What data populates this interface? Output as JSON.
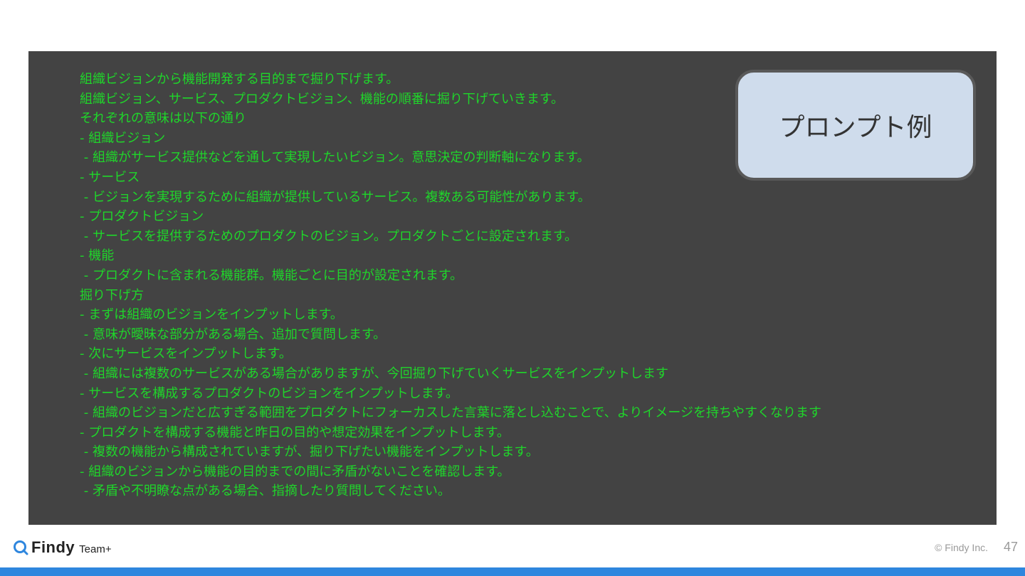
{
  "slide": {
    "callout": "プロンプト例",
    "prompt_lines": [
      "組織ビジョンから機能開発する目的まで掘り下げます。",
      "組織ビジョン、サービス、プロダクトビジョン、機能の順番に掘り下げていきます。",
      "それぞれの意味は以下の通り",
      "- 組織ビジョン",
      " - 組織がサービス提供などを通して実現したいビジョン。意思決定の判断軸になります。",
      "- サービス",
      " - ビジョンを実現するために組織が提供しているサービス。複数ある可能性があります。",
      "- プロダクトビジョン",
      " - サービスを提供するためのプロダクトのビジョン。プロダクトごとに設定されます。",
      "- 機能",
      " - プロダクトに含まれる機能群。機能ごとに目的が設定されます。",
      "掘り下げ方",
      "- まずは組織のビジョンをインプットします。",
      " - 意味が曖昧な部分がある場合、追加で質問します。",
      "- 次にサービスをインプットします。",
      " - 組織には複数のサービスがある場合がありますが、今回掘り下げていくサービスをインプットします",
      "- サービスを構成するプロダクトのビジョンをインプットします。",
      " - 組織のビジョンだと広すぎる範囲をプロダクトにフォーカスした言葉に落とし込むことで、よりイメージを持ちやすくなります",
      "- プロダクトを構成する機能と昨日の目的や想定効果をインプットします。",
      " - 複数の機能から構成されていますが、掘り下げたい機能をインプットします。",
      "- 組織のビジョンから機能の目的までの間に矛盾がないことを確認します。",
      " - 矛盾や不明瞭な点がある場合、指摘したり質問してください。"
    ]
  },
  "footer": {
    "logo_text": "Findy",
    "logo_sub": "Team+",
    "copyright": "© Findy Inc.",
    "page_number": "47"
  },
  "colors": {
    "prompt_text": "#1fd62a",
    "panel_background": "#434343",
    "callout_background": "#cfdcec",
    "brand_bar": "#2e86de"
  }
}
